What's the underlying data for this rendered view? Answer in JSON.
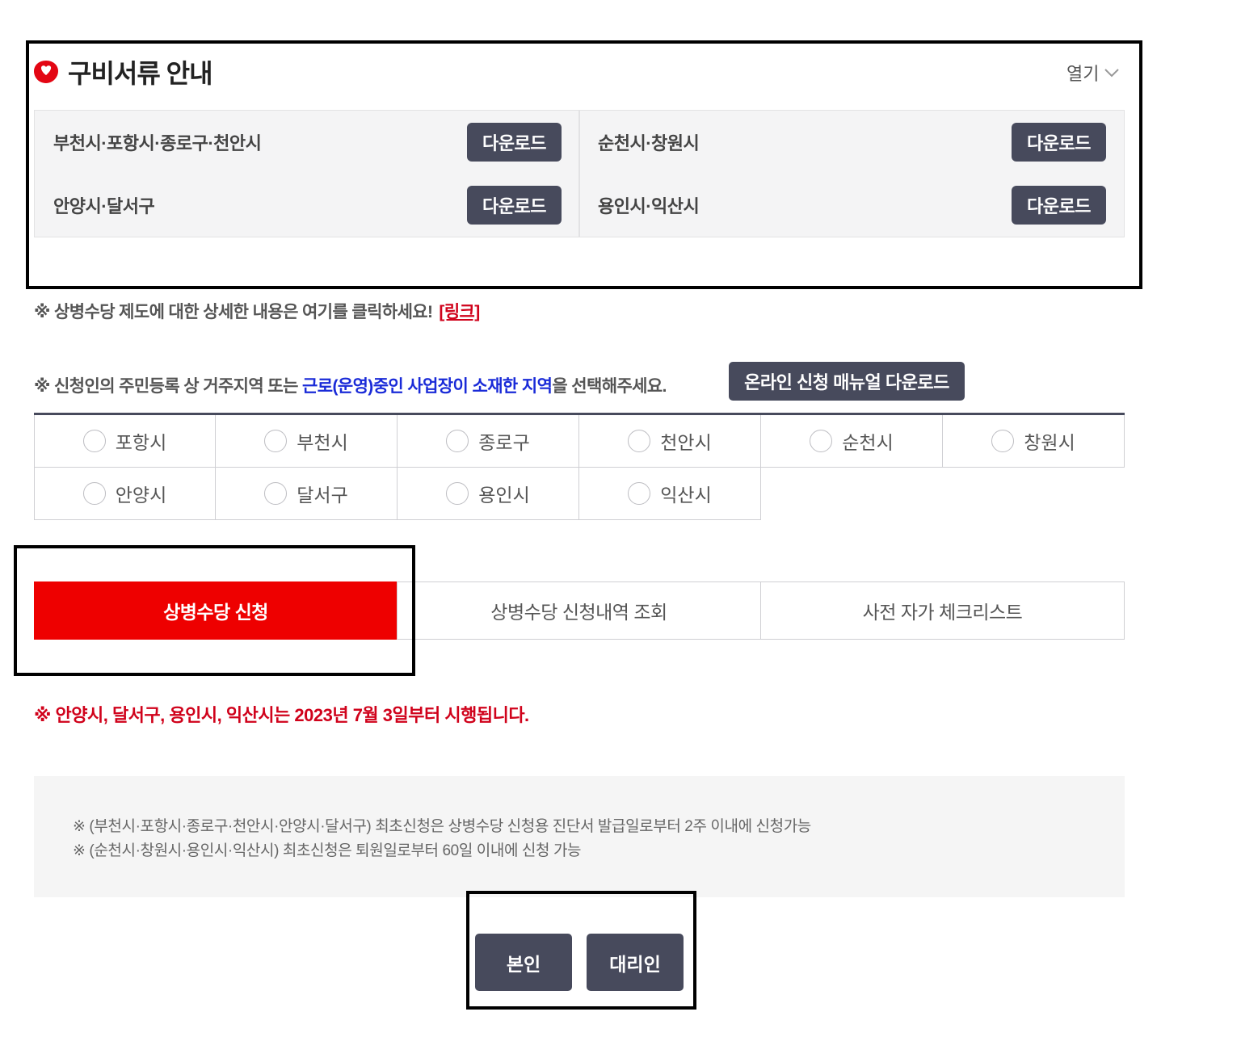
{
  "docs": {
    "title": "구비서류 안내",
    "toggle_label": "열기",
    "download_label": "다운로드",
    "items": [
      {
        "label": "부천시·포항시·종로구·천안시"
      },
      {
        "label": "순천시·창원시"
      },
      {
        "label": "안양시·달서구"
      },
      {
        "label": "용인시·익산시"
      }
    ]
  },
  "note_detail": {
    "text": "※ 상병수당 제도에 대한 상세한 내용은 여기를 클릭하세요!",
    "link_label": "[링크]"
  },
  "note_region": {
    "prefix": "※ 신청인의 주민등록 상 거주지역 또는 ",
    "highlight": "근로(운영)중인 사업장이 소재한 지역",
    "suffix": "을 선택해주세요."
  },
  "manual_button": "온라인 신청 매뉴얼 다운로드",
  "regions": [
    "포항시",
    "부천시",
    "종로구",
    "천안시",
    "순천시",
    "창원시",
    "안양시",
    "달서구",
    "용인시",
    "익산시"
  ],
  "tabs": [
    {
      "label": "상병수당 신청",
      "active": true
    },
    {
      "label": "상병수당 신청내역 조회",
      "active": false
    },
    {
      "label": "사전 자가 체크리스트",
      "active": false
    }
  ],
  "notice_red": "※ 안양시, 달서구, 용인시, 익산시는 2023년 7월 3일부터 시행됩니다.",
  "info": {
    "line1": "※ (부천시·포항시·종로구·천안시·안양시·달서구) 최초신청은 상병수당 신청용 진단서 발급일로부터 2주 이내에 신청가능",
    "line2": "※ (순천시·창원시·용인시·익산시) 최초신청은 퇴원일로부터 60일 이내에 신청 가능"
  },
  "applicant_buttons": {
    "self": "본인",
    "proxy": "대리인"
  },
  "colors": {
    "accent_red": "#ee0000",
    "button_dark": "#474a5c",
    "link_blue": "#1a2bd8",
    "notice_red": "#d0021b"
  }
}
